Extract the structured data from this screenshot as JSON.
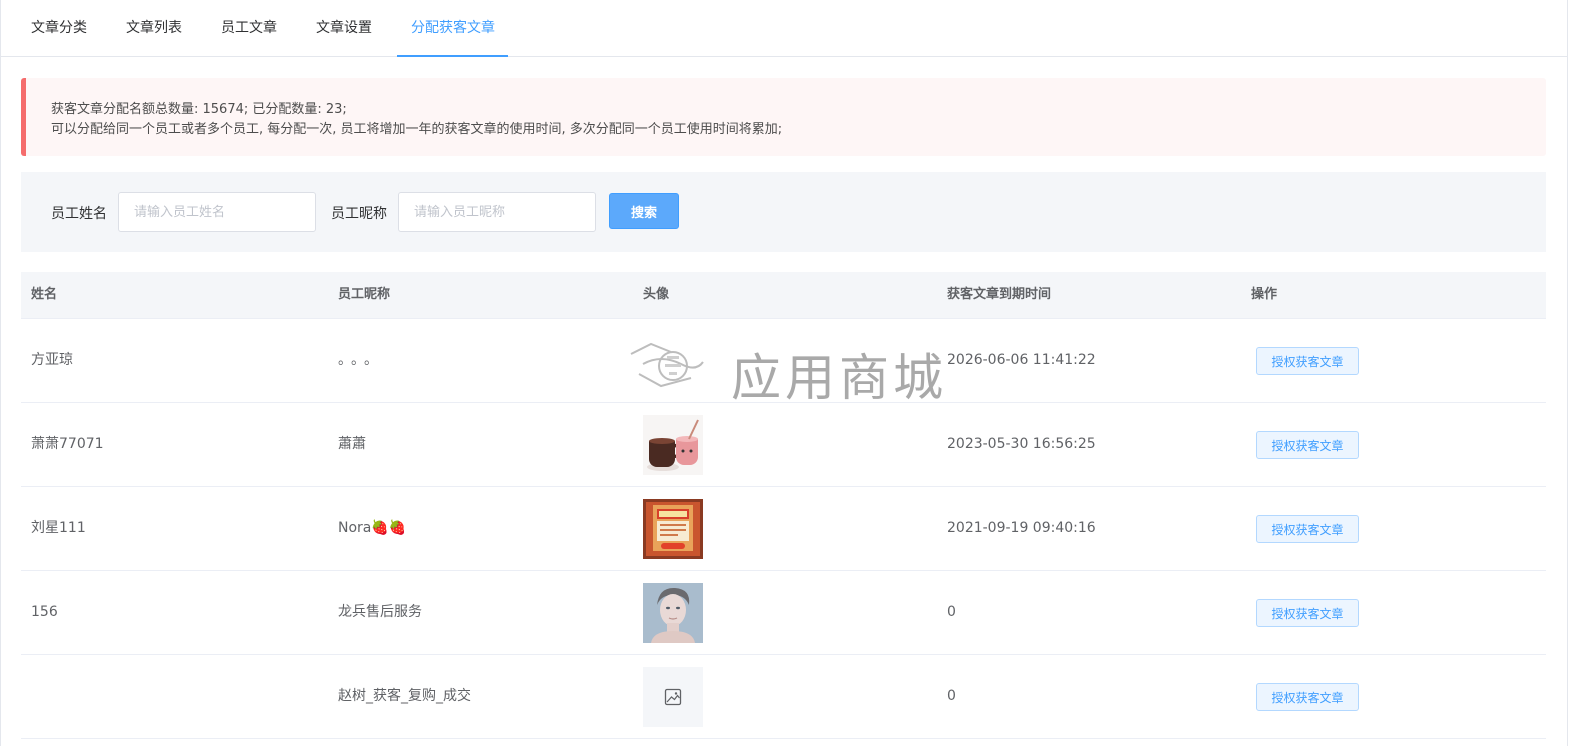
{
  "tabs": [
    {
      "label": "文章分类",
      "active": false
    },
    {
      "label": "文章列表",
      "active": false
    },
    {
      "label": "员工文章",
      "active": false
    },
    {
      "label": "文章设置",
      "active": false
    },
    {
      "label": "分配获客文章",
      "active": true
    }
  ],
  "alert": {
    "line1": "获客文章分配名额总数量: 15674; 已分配数量: 23;",
    "line2": "可以分配给同一个员工或者多个员工, 每分配一次, 员工将增加一年的获客文章的使用时间, 多次分配同一个员工使用时间将累加;",
    "accent_color": "#f56c6c"
  },
  "search": {
    "name_label": "员工姓名",
    "name_placeholder": "请输入员工姓名",
    "name_value": "",
    "nick_label": "员工昵称",
    "nick_placeholder": "请输入员工昵称",
    "nick_value": "",
    "button_label": "搜索"
  },
  "table": {
    "headers": [
      "姓名",
      "员工昵称",
      "头像",
      "获客文章到期时间",
      "操作"
    ],
    "rows": [
      {
        "name": "方亚琼",
        "nickname": "。。。",
        "avatar": "blank-avatar",
        "expire": "2026-06-06 11:41:22",
        "action": "授权获客文章"
      },
      {
        "name": "萧萧77071",
        "nickname": "蕭蕭",
        "avatar": "cups-photo-avatar",
        "expire": "2023-05-30 16:56:25",
        "action": "授权获客文章"
      },
      {
        "name": "刘星111",
        "nickname": "Nora🍓🍓",
        "avatar": "promo-poster-avatar",
        "expire": "2021-09-19 09:40:16",
        "action": "授权获客文章"
      },
      {
        "name": "156",
        "nickname": "龙兵售后服务",
        "avatar": "portrait-photo-avatar",
        "expire": "0",
        "action": "授权获客文章"
      },
      {
        "name": "",
        "nickname": "赵树_获客_复购_成交",
        "avatar": "image-placeholder-icon",
        "expire": "0",
        "action": "授权获客文章"
      }
    ]
  },
  "watermark": {
    "text": "应用商城"
  },
  "colors": {
    "primary": "#409eff",
    "tab_active": "#409eff",
    "panel_bg": "#f4f6f9",
    "alert_bg": "#fef6f6"
  }
}
